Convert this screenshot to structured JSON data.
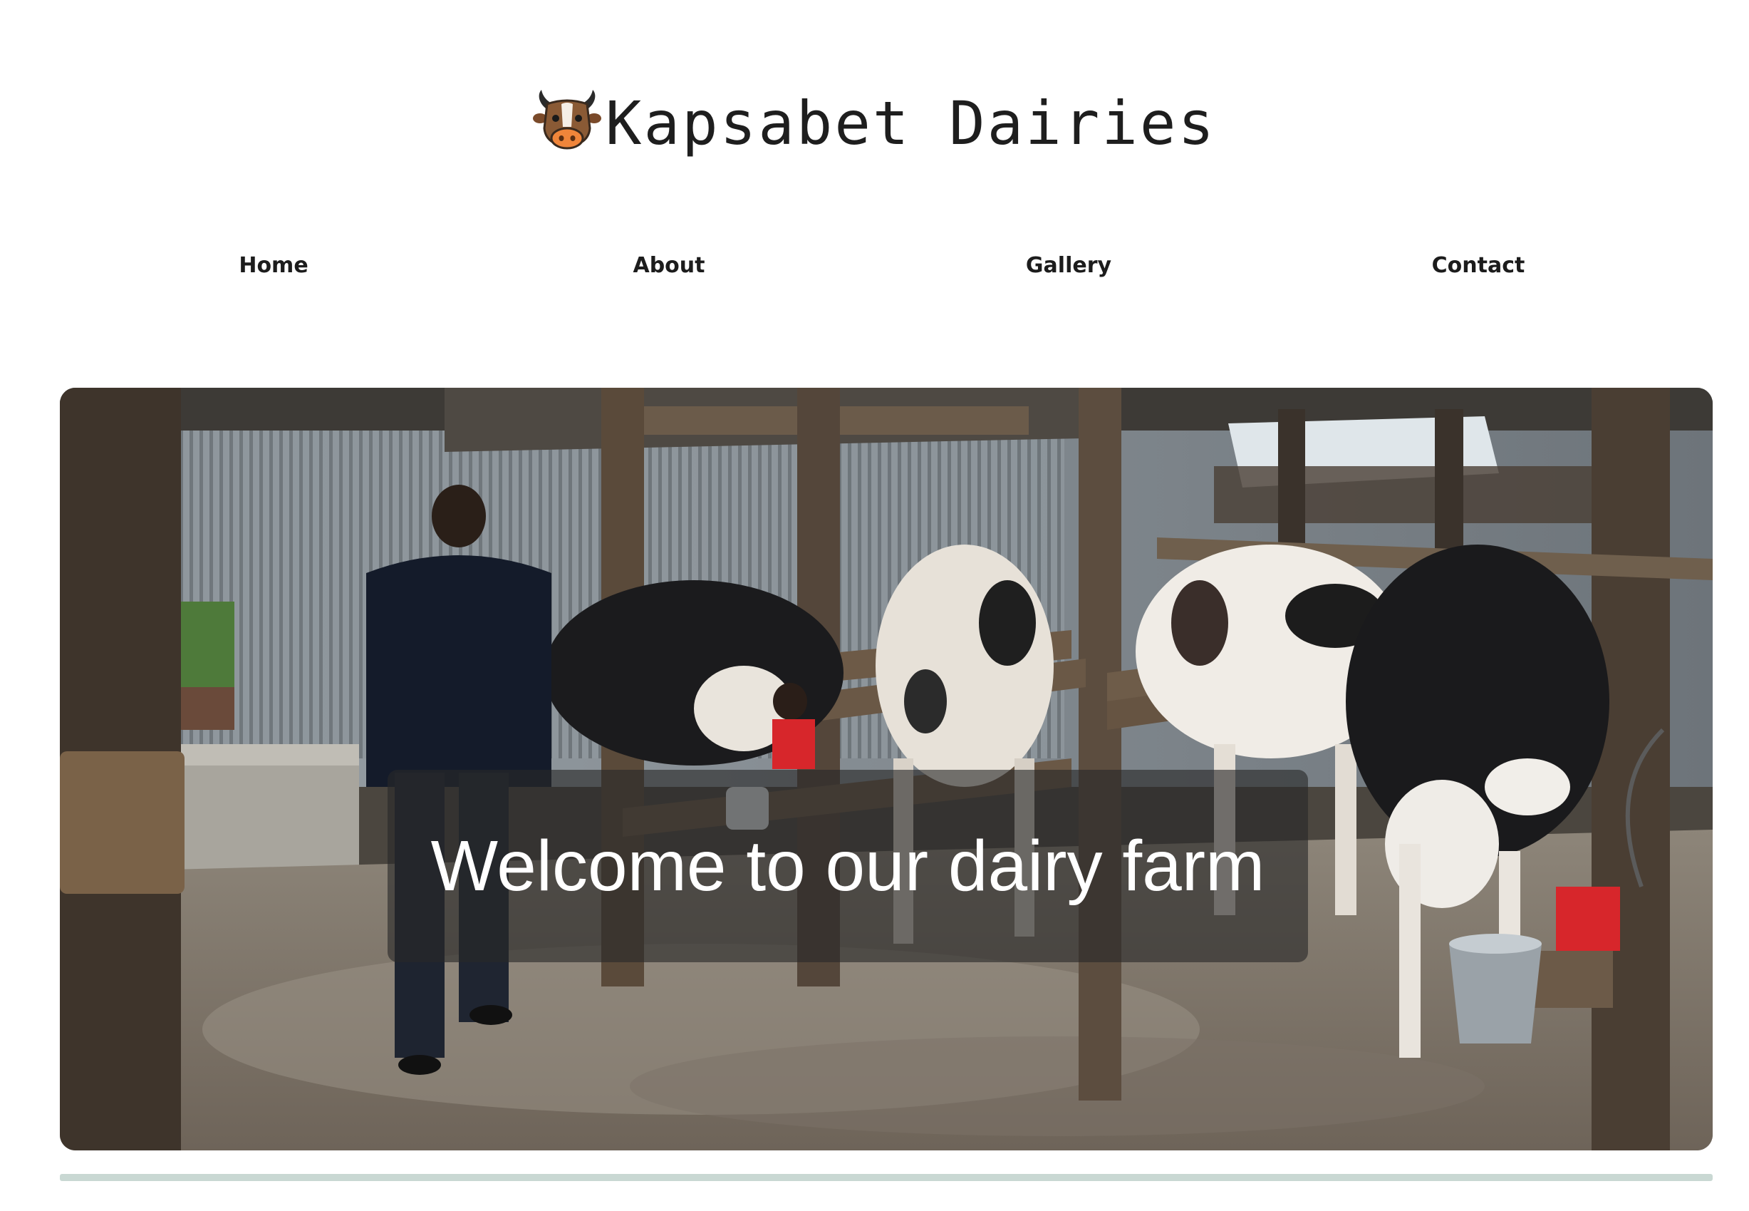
{
  "header": {
    "logo_icon": "cow-face-icon",
    "site_name": "Kapsabet Dairies"
  },
  "nav": {
    "items": [
      {
        "label": "Home"
      },
      {
        "label": "About"
      },
      {
        "label": "Gallery"
      },
      {
        "label": "Contact"
      }
    ]
  },
  "hero": {
    "image": "dairy-milking-shed-photo",
    "caption": "Welcome to our dairy farm"
  },
  "colors": {
    "background": "#ffffff",
    "text": "#1f1f1f",
    "caption_overlay": "rgba(40,40,40,0.62)",
    "divider": "#c9d8d3"
  }
}
